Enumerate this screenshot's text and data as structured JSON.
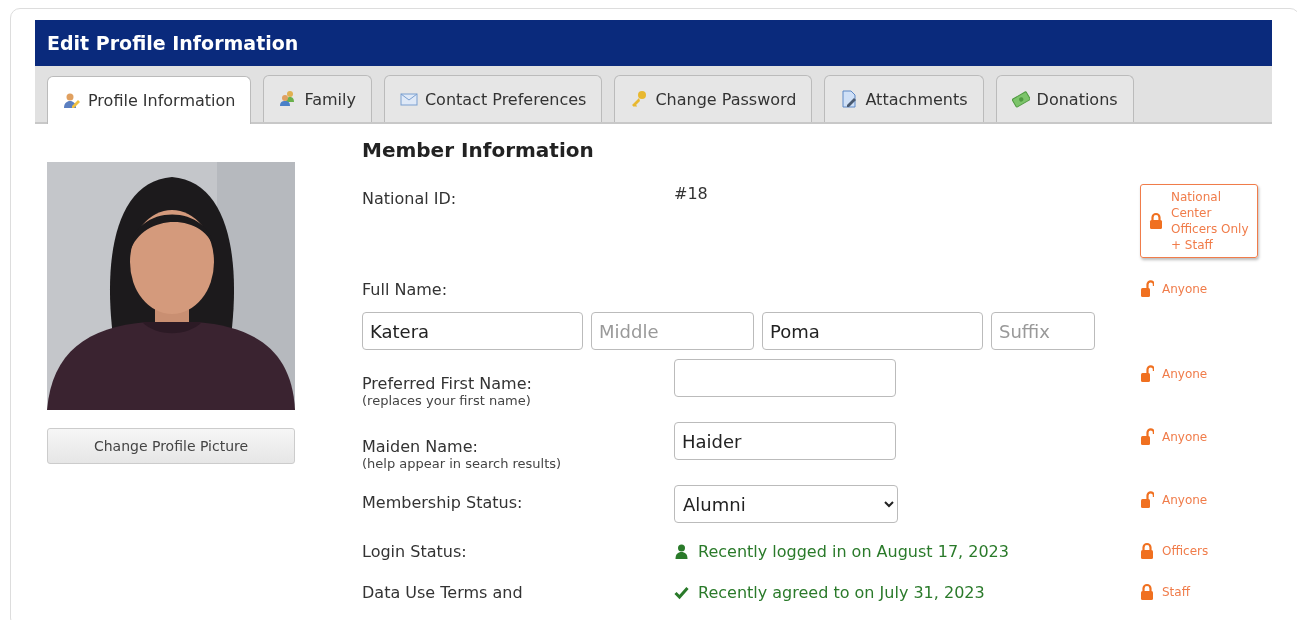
{
  "panel": {
    "title": "Edit Profile Information"
  },
  "tabs": [
    {
      "label": "Profile Information",
      "selected": true
    },
    {
      "label": "Family",
      "selected": false
    },
    {
      "label": "Contact Preferences",
      "selected": false
    },
    {
      "label": "Change Password",
      "selected": false
    },
    {
      "label": "Attachments",
      "selected": false
    },
    {
      "label": "Donations",
      "selected": false
    }
  ],
  "profile": {
    "button": "Change Profile Picture"
  },
  "section_title": "Member Information",
  "fields": [
    {
      "kind": "text",
      "label": "National ID:",
      "value": "#18",
      "privacy": {
        "label": "National Center Officers Only + Staff",
        "locked": true,
        "boxed": true
      }
    },
    {
      "kind": "name",
      "label": "Full Name:",
      "inputs": [
        {
          "value": "Katera"
        },
        {
          "placeholder": "Middle"
        },
        {
          "value": "Poma"
        },
        {
          "placeholder": "Suffix"
        }
      ],
      "privacy": {
        "label": "Anyone",
        "locked": false,
        "boxed": false
      }
    },
    {
      "kind": "input",
      "label": "Preferred First Name:",
      "hint": "(replaces your first name)",
      "privacy": {
        "label": "Anyone",
        "locked": false,
        "boxed": false
      }
    },
    {
      "kind": "input",
      "label": "Maiden Name:",
      "hint": "(help appear in search results)",
      "value": "Haider",
      "privacy": {
        "label": "Anyone",
        "locked": false,
        "boxed": false
      }
    },
    {
      "kind": "select",
      "label": "Membership Status:",
      "value": "Alumni",
      "privacy": {
        "label": "Anyone",
        "locked": false,
        "boxed": false
      }
    },
    {
      "kind": "login_status",
      "label": "Login Status:",
      "value": "Recently logged in on August 17, 2023",
      "privacy": {
        "label": "Officers",
        "locked": true,
        "boxed": false
      }
    },
    {
      "kind": "agreement_status",
      "label": "Data Use Terms and",
      "value": "Recently agreed to on July 31, 2023",
      "privacy": {
        "label": "Staff",
        "locked": true,
        "boxed": false
      }
    }
  ]
}
